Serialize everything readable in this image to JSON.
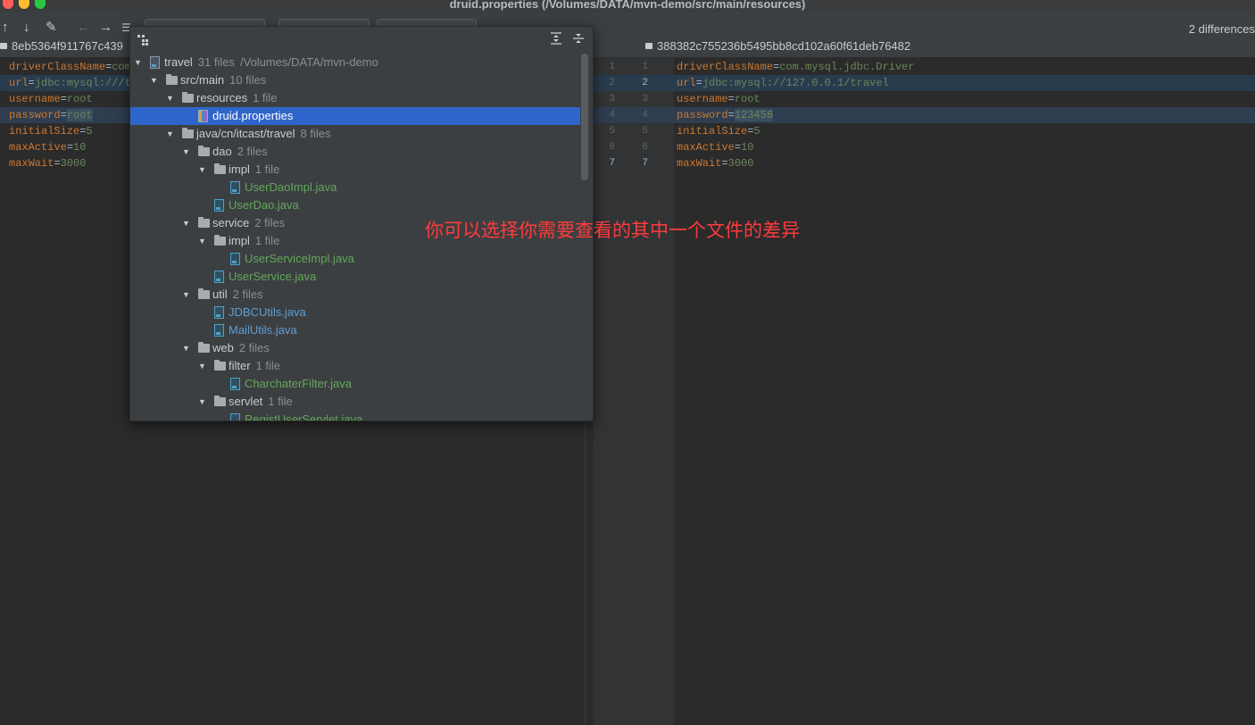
{
  "window": {
    "title": "druid.properties (/Volumes/DATA/mvn-demo/src/main/resources)"
  },
  "toolbar": {
    "diff_count": "2 differences"
  },
  "left_header": {
    "revision": "8eb5364f911767c439"
  },
  "right_header": {
    "revision": "388382c755236b5495bb8cd102a60f61deb76482"
  },
  "left_editor": {
    "lines": [
      {
        "key": "driverClassName",
        "value": "com"
      },
      {
        "key": "url",
        "value": "jdbc:mysql:///t"
      },
      {
        "key": "username",
        "value": "root"
      },
      {
        "key": "password",
        "value": "root"
      },
      {
        "key": "initialSize",
        "value": "5"
      },
      {
        "key": "maxActive",
        "value": "10"
      },
      {
        "key": "maxWait",
        "value": "3000"
      }
    ]
  },
  "gutter": {
    "left_numbers": [
      "1",
      "2",
      "3",
      "4",
      "5",
      "6",
      "7"
    ],
    "right_numbers": [
      "1",
      "2",
      "3",
      "4",
      "5",
      "6",
      "7"
    ]
  },
  "right_editor": {
    "lines": [
      {
        "key": "driverClassName",
        "value": "com.mysql.jdbc.Driver"
      },
      {
        "key": "url",
        "value": "jdbc:mysql://127.0.0.1/travel"
      },
      {
        "key": "username",
        "value": "root"
      },
      {
        "key": "password",
        "value": "123456"
      },
      {
        "key": "initialSize",
        "value": "5"
      },
      {
        "key": "maxActive",
        "value": "10"
      },
      {
        "key": "maxWait",
        "value": "3000"
      }
    ]
  },
  "file_tree": {
    "rows": [
      {
        "name": "travel",
        "count": "31 files",
        "path": "/Volumes/DATA/mvn-demo"
      },
      {
        "name": "src/main",
        "count": "10 files"
      },
      {
        "name": "resources",
        "count": "1 file"
      },
      {
        "name": "druid.properties"
      },
      {
        "name": "java/cn/itcast/travel",
        "count": "8 files"
      },
      {
        "name": "dao",
        "count": "2 files"
      },
      {
        "name": "impl",
        "count": "1 file"
      },
      {
        "name": "UserDaoImpl.java"
      },
      {
        "name": "UserDao.java"
      },
      {
        "name": "service",
        "count": "2 files"
      },
      {
        "name": "impl",
        "count": "1 file"
      },
      {
        "name": "UserServiceImpl.java"
      },
      {
        "name": "UserService.java"
      },
      {
        "name": "util",
        "count": "2 files"
      },
      {
        "name": "JDBCUtils.java"
      },
      {
        "name": "MailUtils.java"
      },
      {
        "name": "web",
        "count": "2 files"
      },
      {
        "name": "filter",
        "count": "1 file"
      },
      {
        "name": "CharchaterFilter.java"
      },
      {
        "name": "servlet",
        "count": "1 file"
      },
      {
        "name": "RegistUserServlet.java"
      }
    ]
  },
  "annotation": {
    "text": "你可以选择你需要查看的其中一个文件的差异"
  },
  "colors": {
    "selection": "#2f65ca",
    "annotation": "#ff3b3b",
    "changed_line": "#293c4e"
  }
}
